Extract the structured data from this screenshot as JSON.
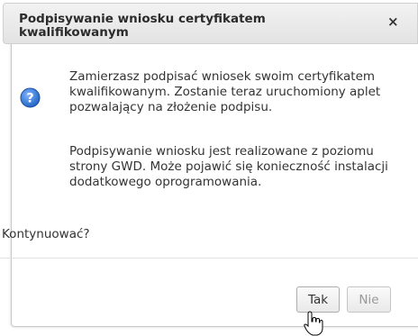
{
  "dialog": {
    "title": "Podpisywanie wniosku certyfikatem kwalifikowanym",
    "close_glyph": "×",
    "message_1": "Zamierzasz podpisać wniosek swoim certyfikatem kwalifikowanym. Zostanie teraz uruchomiony aplet pozwalający na złożenie podpisu.",
    "message_2": "Podpisywanie wniosku jest realizowane z poziomu strony GWD. Może pojawić się konieczność instalacji dodatkowego oprogramowania.",
    "question": "Kontynuować?",
    "buttons": {
      "yes": "Tak",
      "no": "Nie"
    },
    "icon": "question-icon",
    "accent": "#2b6cc4"
  }
}
